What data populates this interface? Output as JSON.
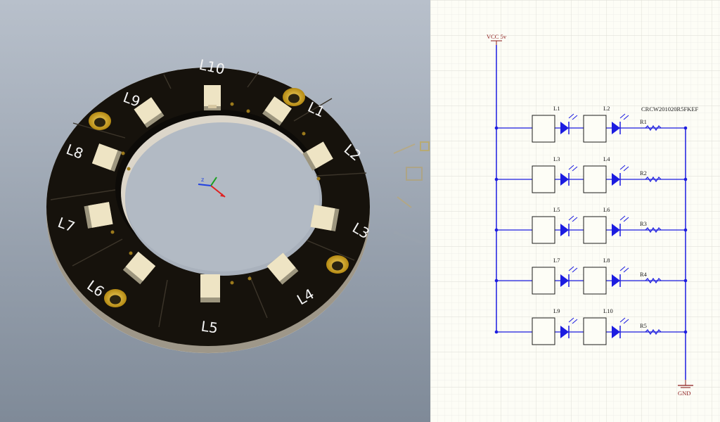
{
  "pcb": {
    "led_labels": [
      "L1",
      "L2",
      "L3",
      "L4",
      "L5",
      "L6",
      "L7",
      "L8",
      "L9",
      "L10"
    ]
  },
  "schematic": {
    "vcc_label": "VCC 5v",
    "gnd_label": "GND",
    "resistor_part": "CRCW201020R5FKEF",
    "rows": [
      {
        "led_a": "L1",
        "led_b": "L2",
        "resistor": "R1"
      },
      {
        "led_a": "L3",
        "led_b": "L4",
        "resistor": "R2"
      },
      {
        "led_a": "L5",
        "led_b": "L6",
        "resistor": "R3"
      },
      {
        "led_a": "L7",
        "led_b": "L8",
        "resistor": "R4"
      },
      {
        "led_a": "L9",
        "led_b": "L10",
        "resistor": "R5"
      }
    ]
  },
  "colors": {
    "board": "#16120c",
    "pad_gold": "#c9a022",
    "led_body": "#eee4c4",
    "wire_blue": "#1c1ce0",
    "symbol_red": "#8b1a1a",
    "grid": "#e9e9e4",
    "schematic_bg": "#fdfdf6"
  }
}
